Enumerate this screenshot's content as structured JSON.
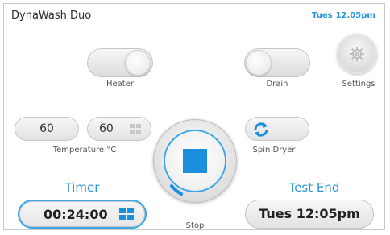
{
  "header": {
    "title": "DynaWash Duo",
    "clock_day": "Tues",
    "clock_time": "12.05pm"
  },
  "controls": {
    "heater_label": "Heater",
    "drain_label": "Drain",
    "settings_label": "Settings",
    "temperature_value_1": "60",
    "temperature_value_2": "60",
    "temperature_label": "Temperature °C",
    "stop_label": "Stop",
    "spin_dryer_label": "Spin Dryer"
  },
  "timer": {
    "heading": "Timer",
    "value": "00:24:00"
  },
  "test_end": {
    "heading": "Test End",
    "value": "Tues  12:05pm"
  },
  "colors": {
    "accent": "#2a97d8",
    "stop_square": "#1b8fdc"
  }
}
